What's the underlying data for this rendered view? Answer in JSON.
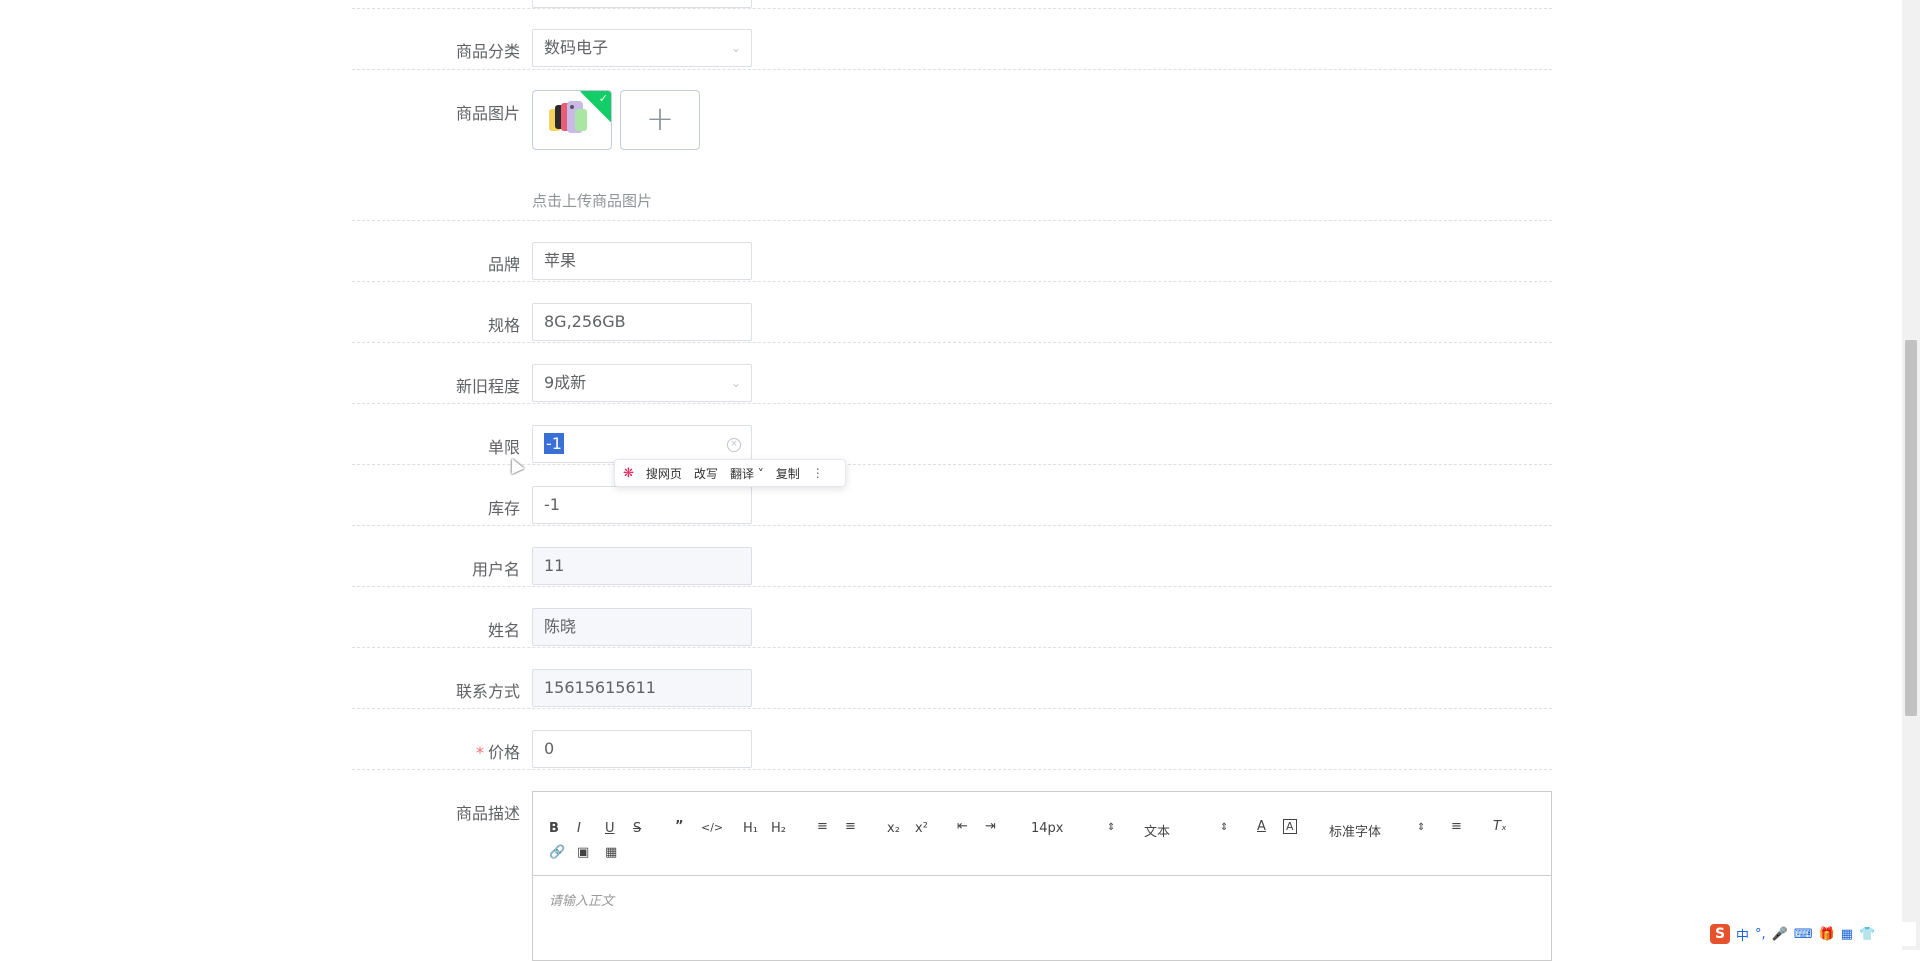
{
  "form": {
    "category": {
      "label": "商品分类",
      "value": "数码电子"
    },
    "images": {
      "label": "商品图片",
      "hint": "点击上传商品图片"
    },
    "brand": {
      "label": "品牌",
      "value": "苹果"
    },
    "spec": {
      "label": "规格",
      "value": "8G,256GB"
    },
    "condition": {
      "label": "新旧程度",
      "value": "9成新"
    },
    "limit": {
      "label": "单限",
      "value": "-1"
    },
    "stock": {
      "label": "库存",
      "value": "-1"
    },
    "username": {
      "label": "用户名",
      "value": "11"
    },
    "name": {
      "label": "姓名",
      "value": "陈晓"
    },
    "phone": {
      "label": "联系方式",
      "value": "15615615611"
    },
    "price": {
      "label": "价格",
      "required_mark": "*",
      "value": "0"
    },
    "description": {
      "label": "商品描述",
      "placeholder": "请输入正文"
    }
  },
  "context_menu": {
    "search": "搜网页",
    "rewrite": "改写",
    "translate": "翻译",
    "copy": "复制"
  },
  "editor_toolbar": {
    "font_size": "14px",
    "block_type": "文本",
    "font_family": "标准字体",
    "h1": "H₁",
    "h2": "H₂",
    "subscript": "x₂",
    "superscript": "x²"
  },
  "ime": {
    "mode": "中",
    "punct": "°,"
  },
  "colors": {
    "required": "#f56c6c",
    "selection": "#3a6fd8",
    "success_badge": "#13ce66"
  }
}
